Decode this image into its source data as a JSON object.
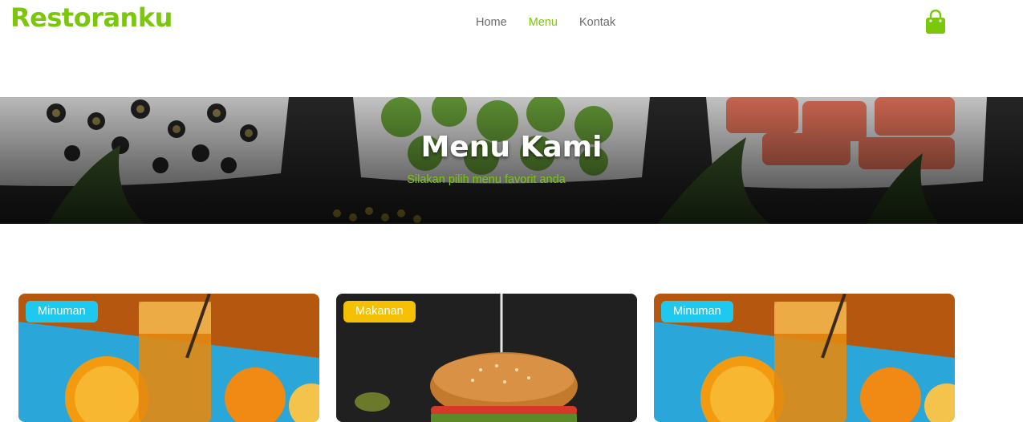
{
  "brand": "Restoranku",
  "nav": {
    "items": [
      {
        "label": "Home"
      },
      {
        "label": "Menu"
      },
      {
        "label": "Kontak"
      }
    ],
    "active": "Menu"
  },
  "cart_icon": "shopping-bag-icon",
  "hero": {
    "title": "Menu Kami",
    "subtitle": "Silakan pilih menu favorit anda"
  },
  "cards": [
    {
      "category": "Minuman",
      "image": "orange-juice-photo"
    },
    {
      "category": "Makanan",
      "image": "burger-photo"
    },
    {
      "category": "Minuman",
      "image": "orange-juice-photo"
    }
  ],
  "colors": {
    "accent": "#7ac70c",
    "badge_drink": "#1ec8ef",
    "badge_food": "#f5c000"
  }
}
